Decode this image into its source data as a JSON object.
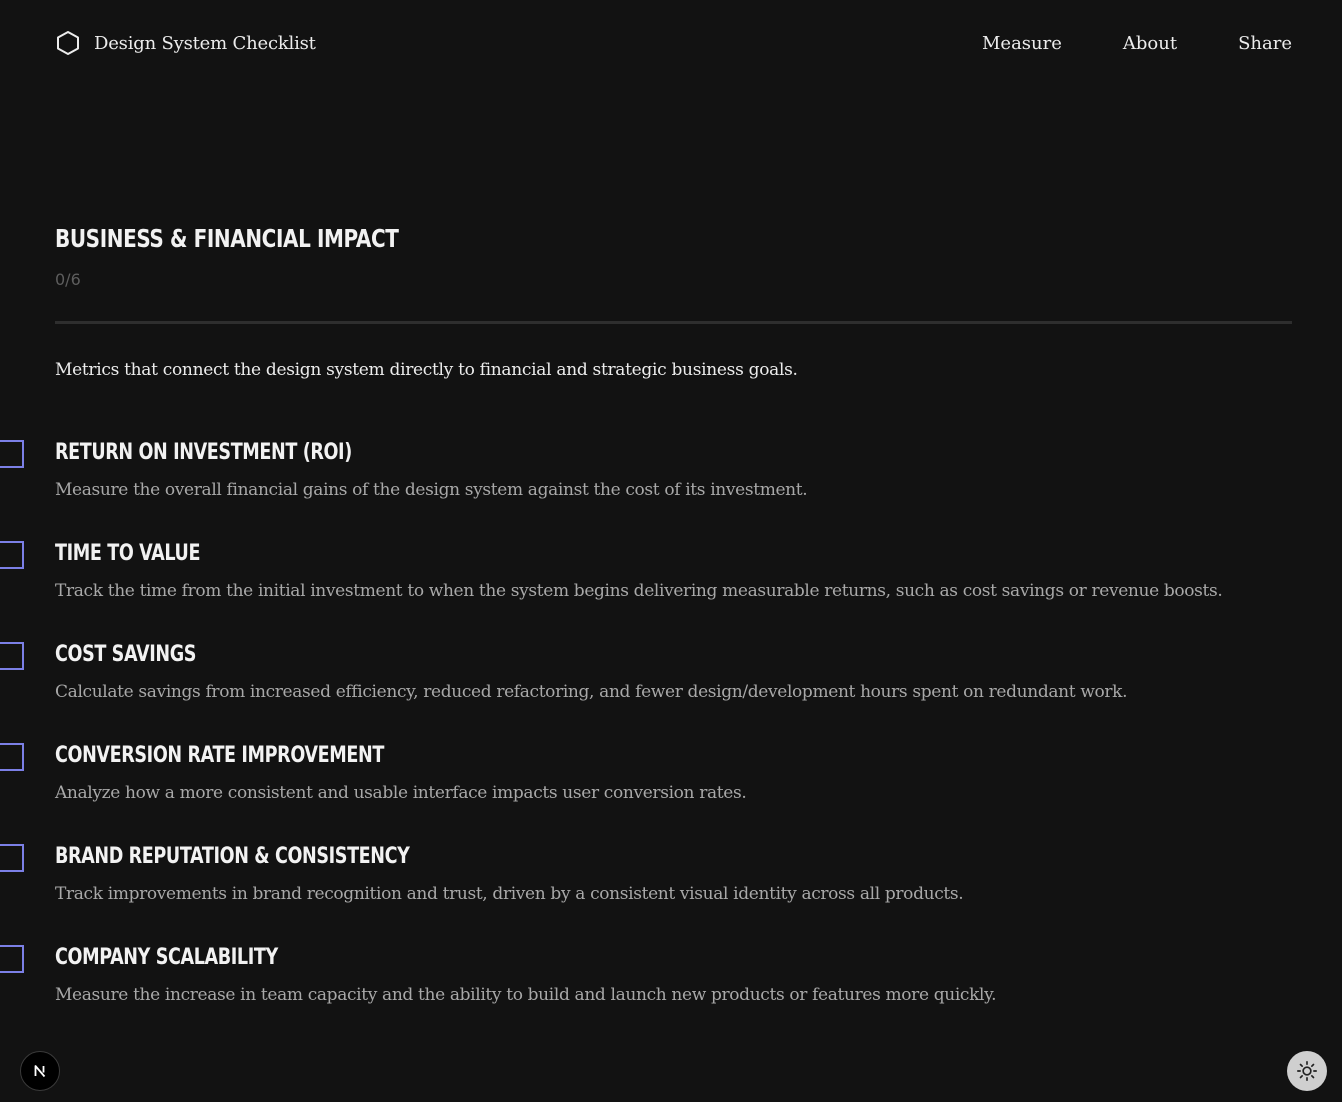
{
  "header": {
    "brand_icon": "hexagon-icon",
    "brand_name": "Design System Checklist",
    "nav": [
      {
        "label": "Measure"
      },
      {
        "label": "About"
      },
      {
        "label": "Share"
      }
    ]
  },
  "section": {
    "title": "BUSINESS & FINANCIAL IMPACT",
    "progress": "0/6",
    "description": "Metrics that connect the design system directly to financial and strategic business goals.",
    "items": [
      {
        "title": "RETURN ON INVESTMENT (ROI)",
        "description": "Measure the overall financial gains of the design system against the cost of its investment.",
        "checked": false
      },
      {
        "title": "TIME TO VALUE",
        "description": "Track the time from the initial investment to when the system begins delivering measurable returns, such as cost savings or revenue boosts.",
        "checked": false
      },
      {
        "title": "COST SAVINGS",
        "description": "Calculate savings from increased efficiency, reduced refactoring, and fewer design/development hours spent on redundant work.",
        "checked": false
      },
      {
        "title": "CONVERSION RATE IMPROVEMENT",
        "description": "Analyze how a more consistent and usable interface impacts user conversion rates.",
        "checked": false
      },
      {
        "title": "BRAND REPUTATION & CONSISTENCY",
        "description": "Track improvements in brand recognition and trust, driven by a consistent visual identity across all products.",
        "checked": false
      },
      {
        "title": "COMPANY SCALABILITY",
        "description": "Measure the increase in team capacity and the ability to build and launch new products or features more quickly.",
        "checked": false
      }
    ]
  },
  "footer": {
    "badge_icon": "nextjs-n-icon",
    "theme_icon": "sun-icon"
  },
  "colors": {
    "background": "#121212",
    "checkbox_accent": "#7b7fe6",
    "text_primary": "#ececec",
    "text_secondary": "#a8a8a8",
    "progress": "#5d5d5d"
  }
}
